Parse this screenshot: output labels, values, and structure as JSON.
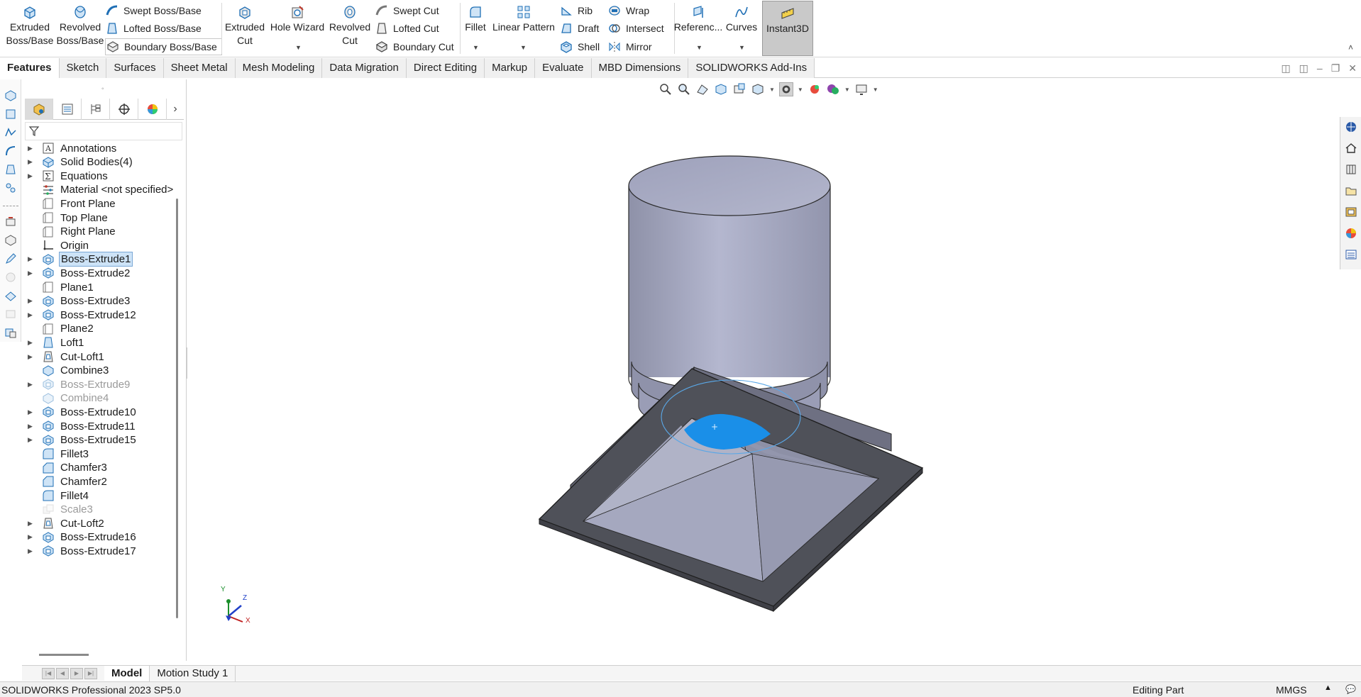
{
  "ribbon": {
    "extruded_boss": "Extruded\nBoss/Base",
    "revolved_boss": "Revolved\nBoss/Base",
    "swept_boss": "Swept Boss/Base",
    "lofted_boss": "Lofted Boss/Base",
    "boundary_boss": "Boundary Boss/Base",
    "extruded_cut": "Extruded\nCut",
    "hole_wizard": "Hole Wizard",
    "revolved_cut": "Revolved\nCut",
    "swept_cut": "Swept Cut",
    "lofted_cut": "Lofted Cut",
    "boundary_cut": "Boundary Cut",
    "fillet": "Fillet",
    "linear_pattern": "Linear Pattern",
    "rib": "Rib",
    "draft": "Draft",
    "shell": "Shell",
    "wrap": "Wrap",
    "intersect": "Intersect",
    "mirror": "Mirror",
    "reference": "Referenc...",
    "curves": "Curves",
    "instant3d": "Instant3D"
  },
  "tabs": [
    "Features",
    "Sketch",
    "Surfaces",
    "Sheet Metal",
    "Mesh Modeling",
    "Data Migration",
    "Direct Editing",
    "Markup",
    "Evaluate",
    "MBD Dimensions",
    "SOLIDWORKS Add-Ins"
  ],
  "tree": [
    {
      "label": "Annotations",
      "expandable": true,
      "icon": "annotations-icon"
    },
    {
      "label": "Solid Bodies(4)",
      "expandable": true,
      "icon": "solid-bodies-icon"
    },
    {
      "label": "Equations",
      "expandable": true,
      "icon": "equations-icon"
    },
    {
      "label": "Material <not specified>",
      "expandable": false,
      "icon": "material-icon"
    },
    {
      "label": "Front Plane",
      "expandable": false,
      "icon": "plane-icon"
    },
    {
      "label": "Top Plane",
      "expandable": false,
      "icon": "plane-icon"
    },
    {
      "label": "Right Plane",
      "expandable": false,
      "icon": "plane-icon"
    },
    {
      "label": "Origin",
      "expandable": false,
      "icon": "origin-icon"
    },
    {
      "label": "Boss-Extrude1",
      "expandable": true,
      "icon": "boss-extrude-icon",
      "selected": true
    },
    {
      "label": "Boss-Extrude2",
      "expandable": true,
      "icon": "boss-extrude-icon"
    },
    {
      "label": "Plane1",
      "expandable": false,
      "icon": "plane-icon"
    },
    {
      "label": "Boss-Extrude3",
      "expandable": true,
      "icon": "boss-extrude-icon"
    },
    {
      "label": "Boss-Extrude12",
      "expandable": true,
      "icon": "boss-extrude-icon"
    },
    {
      "label": "Plane2",
      "expandable": false,
      "icon": "plane-icon"
    },
    {
      "label": "Loft1",
      "expandable": true,
      "icon": "loft-icon"
    },
    {
      "label": "Cut-Loft1",
      "expandable": true,
      "icon": "cut-loft-icon"
    },
    {
      "label": "Combine3",
      "expandable": false,
      "icon": "combine-icon"
    },
    {
      "label": "Boss-Extrude9",
      "expandable": true,
      "icon": "boss-extrude-icon",
      "dim": true
    },
    {
      "label": "Combine4",
      "expandable": false,
      "icon": "combine-icon",
      "dim": true
    },
    {
      "label": "Boss-Extrude10",
      "expandable": true,
      "icon": "boss-extrude-icon"
    },
    {
      "label": "Boss-Extrude11",
      "expandable": true,
      "icon": "boss-extrude-icon"
    },
    {
      "label": "Boss-Extrude15",
      "expandable": true,
      "icon": "boss-extrude-icon"
    },
    {
      "label": "Fillet3",
      "expandable": false,
      "icon": "fillet-icon"
    },
    {
      "label": "Chamfer3",
      "expandable": false,
      "icon": "chamfer-icon"
    },
    {
      "label": "Chamfer2",
      "expandable": false,
      "icon": "chamfer-icon"
    },
    {
      "label": "Fillet4",
      "expandable": false,
      "icon": "fillet-icon"
    },
    {
      "label": "Scale3",
      "expandable": false,
      "icon": "scale-icon",
      "dim": true
    },
    {
      "label": "Cut-Loft2",
      "expandable": true,
      "icon": "cut-loft-icon"
    },
    {
      "label": "Boss-Extrude16",
      "expandable": true,
      "icon": "boss-extrude-icon"
    },
    {
      "label": "Boss-Extrude17",
      "expandable": true,
      "icon": "boss-extrude-icon"
    }
  ],
  "triad": {
    "x": "X",
    "y": "Y",
    "z": "Z"
  },
  "bottom_tabs": [
    "Model",
    "Motion Study 1"
  ],
  "status": {
    "product": "SOLIDWORKS Professional 2023 SP5.0",
    "mode": "Editing Part",
    "units": "MMGS"
  },
  "colors": {
    "accent_blue": "#1a8fe8",
    "selection_bg": "#cde3f7",
    "model_body": "#a6a9c3",
    "model_dark": "#4e5058",
    "instant3d_bg": "#c9c9c9"
  }
}
